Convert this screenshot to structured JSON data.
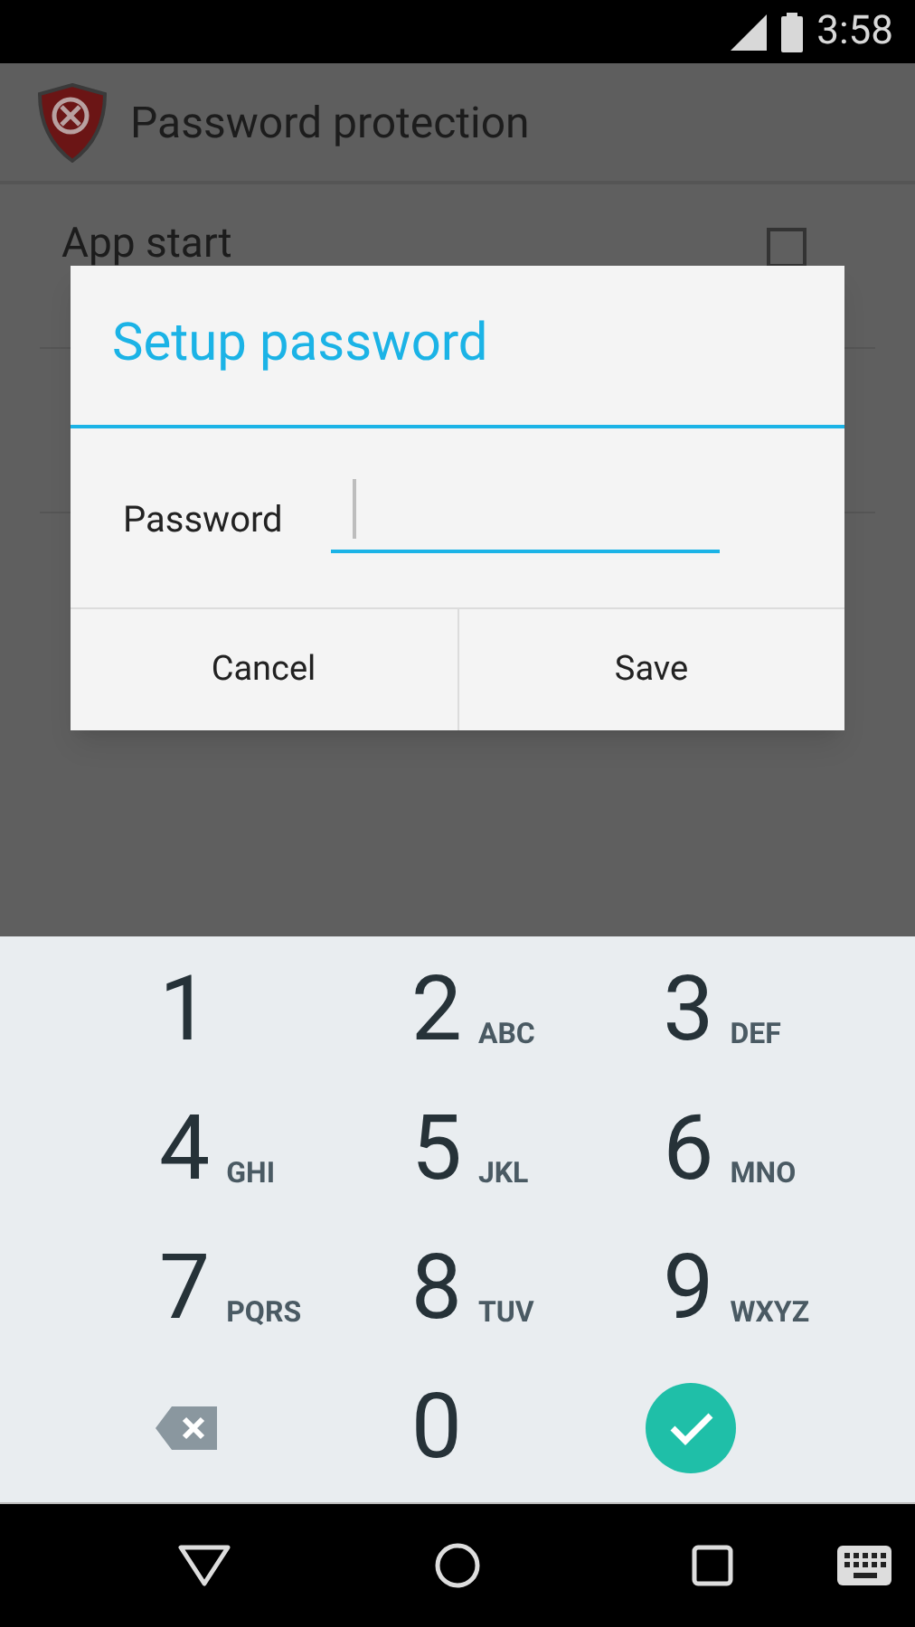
{
  "status_bar": {
    "time": "3:58"
  },
  "app_bar": {
    "title": "Password protection"
  },
  "settings": [
    {
      "kind": "checkbox",
      "title": "App start",
      "checked": false
    }
  ],
  "dialog": {
    "title": "Setup password",
    "field": {
      "label": "Password",
      "focused": true
    },
    "buttons": [
      "Cancel",
      "Save"
    ]
  },
  "keypad": {
    "keys": [
      {
        "kind": "digit",
        "digit": "1"
      },
      {
        "kind": "digit",
        "digit": "2",
        "letters": "ABC"
      },
      {
        "kind": "digit",
        "digit": "3",
        "letters": "DEF"
      },
      {
        "kind": "digit",
        "digit": "4",
        "letters": "GHI"
      },
      {
        "kind": "digit",
        "digit": "5",
        "letters": "JKL"
      },
      {
        "kind": "digit",
        "digit": "6",
        "letters": "MNO"
      },
      {
        "kind": "digit",
        "digit": "7",
        "letters": "PQRS"
      },
      {
        "kind": "digit",
        "digit": "8",
        "letters": "TUV"
      },
      {
        "kind": "digit",
        "digit": "9",
        "letters": "WXYZ"
      },
      {
        "kind": "backspace"
      },
      {
        "kind": "digit",
        "digit": "0"
      },
      {
        "kind": "done"
      }
    ]
  }
}
